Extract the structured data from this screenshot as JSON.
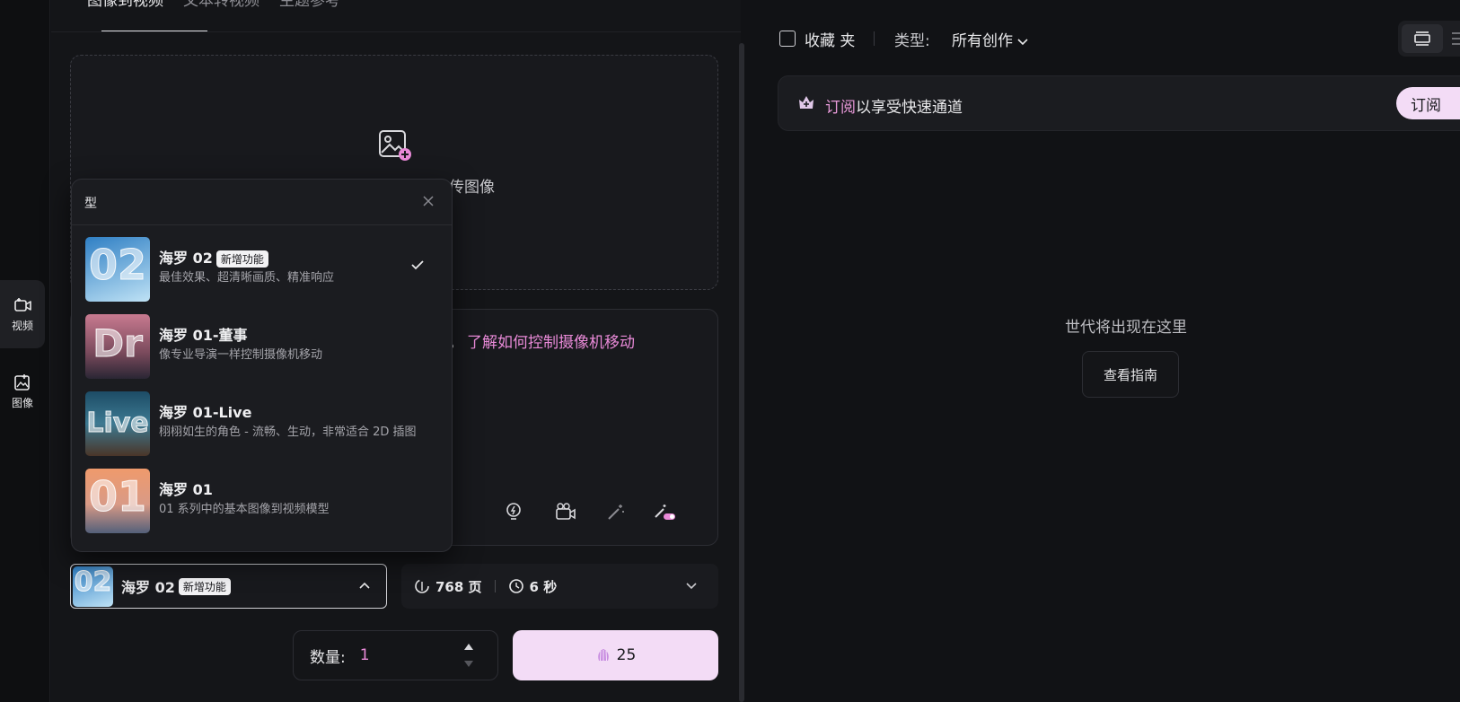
{
  "rail": {
    "video_label": "视频",
    "image_label": "图像"
  },
  "left": {
    "tabs": [
      {
        "label": "图像到视频"
      },
      {
        "label": "文本转视频"
      },
      {
        "label": "主题参考"
      }
    ],
    "upload": {
      "label": "传图像"
    },
    "prompt": {
      "trailing_text": "。",
      "learn_link": "了解如何控制摄像机移动"
    },
    "selected_model": {
      "name": "海罗 02",
      "badge": "新增功能"
    },
    "credits": {
      "pages": "768 页",
      "duration": "6 秒"
    },
    "quantity": {
      "label": "数量:",
      "value": "1"
    },
    "generate": {
      "cost": "25"
    }
  },
  "dropdown": {
    "title": "型",
    "models": [
      {
        "thumb_text": "02",
        "name": "海罗 02",
        "badge": "新增功能",
        "desc": "最佳效果、超清晰画质、精准响应",
        "selected": true,
        "colors": [
          "#2f7fc4",
          "#bfe2f5"
        ]
      },
      {
        "thumb_text": "Dr",
        "name": "海罗 01-董事",
        "desc": "像专业导演一样控制摄像机移动",
        "colors": [
          "#b7637d",
          "#2a2634"
        ]
      },
      {
        "thumb_text": "Live",
        "name": "海罗 01-Live",
        "desc": "栩栩如生的角色 - 流畅、生动，非常适合 2D 插图",
        "colors": [
          "#2d5d78",
          "#4a3528"
        ]
      },
      {
        "thumb_text": "01",
        "name": "海罗 01",
        "desc": "01 系列中的基本图像到视频模型",
        "colors": [
          "#e89a6c",
          "#54607a"
        ]
      }
    ]
  },
  "right": {
    "favorites_label": "收藏 夹",
    "type_label": "类型:",
    "type_value": "所有创作",
    "subscribe": {
      "highlight": "订阅",
      "rest": "以享受快速通道",
      "button": "订阅"
    },
    "empty_text": "世代将出现在这里",
    "guide_button": "查看指南"
  },
  "colors": {
    "accent_pink": "#e98ad8",
    "cta_bg": "#f3dcf6",
    "bg": "#111215"
  }
}
